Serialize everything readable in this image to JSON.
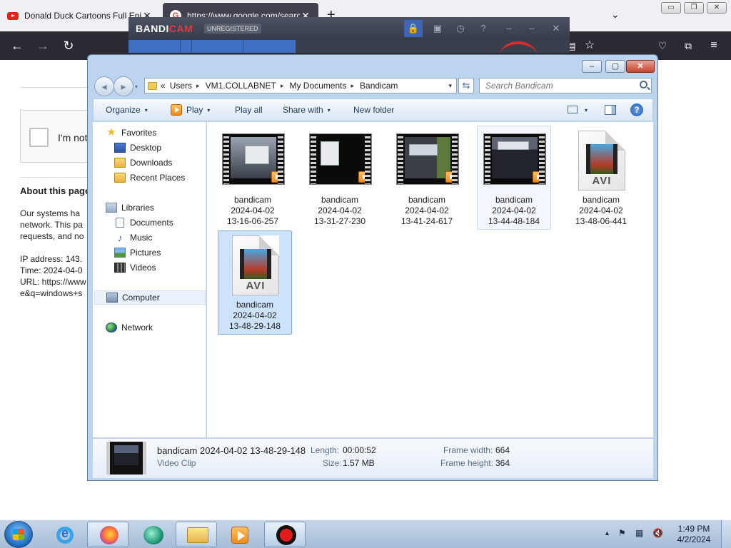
{
  "browser": {
    "tabs": [
      {
        "title": "Donald Duck Cartoons Full Epi",
        "close": "✕"
      },
      {
        "title": "https://www.google.com/searc",
        "close": "✕"
      }
    ],
    "new_tab": "+",
    "tab_list": "⌄",
    "window_controls": {
      "minimize": "▭",
      "restore": "❐",
      "close": "✕"
    },
    "nav": {
      "back": "←",
      "forward": "→",
      "reload": "↻"
    },
    "toolbar_icons": [
      "bookmark-star-icon",
      "pocket-icon",
      "extensions-icon",
      "menu-icon"
    ]
  },
  "page": {
    "captcha_label": "I'm not",
    "about_heading": "About this page",
    "paragraph": [
      "Our systems ha",
      "network. This pa",
      "requests, and no"
    ],
    "ip_line": "IP address: 143.",
    "time_line": "Time: 2024-04-0",
    "url_line": "URL: https://www",
    "url_line2": "e&q=windows+s"
  },
  "bandicam": {
    "brand_a": "BANDI",
    "brand_b": "CAM",
    "badge": "UNREGISTERED",
    "buttons": {
      "lock": "🔒",
      "folder": "▣",
      "timer": "◷",
      "help": "?",
      "collapse": "–",
      "minimize": "–",
      "close": "✕"
    }
  },
  "explorer": {
    "controls": {
      "minimize": "–",
      "maximize": "▢",
      "close": "✕"
    },
    "nav": {
      "back": "◂",
      "forward": "▸",
      "history": "▾"
    },
    "address": {
      "overflow": "«",
      "segments": [
        "Users",
        "VM1.COLLABNET",
        "My Documents",
        "Bandicam"
      ],
      "separator": "▸",
      "dropdown": "▾"
    },
    "refresh": "⇆",
    "search_placeholder": "Search Bandicam",
    "commands": {
      "organize": "Organize",
      "play": "Play",
      "play_all": "Play all",
      "share_with": "Share with",
      "new_folder": "New folder",
      "dropdown": "▾",
      "help": "?"
    },
    "nav_pane": {
      "favorites": "Favorites",
      "desktop": "Desktop",
      "downloads": "Downloads",
      "recent_places": "Recent Places",
      "libraries": "Libraries",
      "documents": "Documents",
      "music": "Music",
      "pictures": "Pictures",
      "videos": "Videos",
      "computer": "Computer",
      "network": "Network"
    },
    "files": [
      {
        "name": "bandicam",
        "date": "2024-04-02",
        "time": "13-16-06-257"
      },
      {
        "name": "bandicam",
        "date": "2024-04-02",
        "time": "13-31-27-230"
      },
      {
        "name": "bandicam",
        "date": "2024-04-02",
        "time": "13-41-24-617"
      },
      {
        "name": "bandicam",
        "date": "2024-04-02",
        "time": "13-44-48-184"
      },
      {
        "name": "bandicam",
        "date": "2024-04-02",
        "time": "13-48-06-441",
        "tag": "AVI"
      },
      {
        "name": "bandicam",
        "date": "2024-04-02",
        "time": "13-48-29-148",
        "tag": "AVI"
      }
    ],
    "details": {
      "title": "bandicam 2024-04-02 13-48-29-148",
      "type": "Video Clip",
      "length_label": "Length:",
      "length": "00:00:52",
      "size_label": "Size:",
      "size": "1.57 MB",
      "fw_label": "Frame width:",
      "fw": "664",
      "fh_label": "Frame height:",
      "fh": "364"
    }
  },
  "taskbar": {
    "tray": {
      "chevron": "▲",
      "flag": "⚑",
      "network": "▦",
      "volume": "🔇"
    },
    "time": "1:49 PM",
    "date": "4/2/2024"
  }
}
